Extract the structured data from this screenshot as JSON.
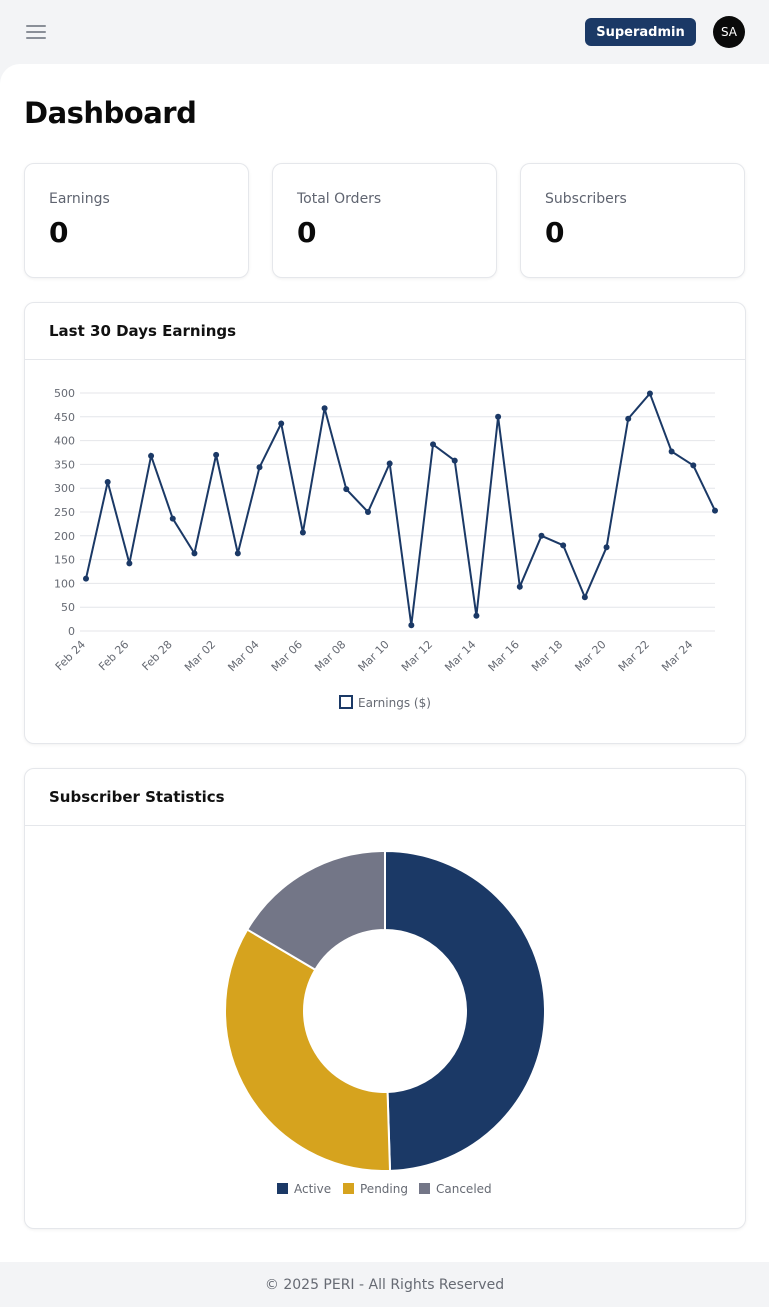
{
  "header": {
    "role_badge": "Superadmin",
    "avatar_initials": "SA"
  },
  "page": {
    "title": "Dashboard"
  },
  "stats": [
    {
      "label": "Earnings",
      "value": "0"
    },
    {
      "label": "Total Orders",
      "value": "0"
    },
    {
      "label": "Subscribers",
      "value": "0"
    }
  ],
  "earnings_panel": {
    "title": "Last 30 Days Earnings"
  },
  "subscriber_panel": {
    "title": "Subscriber Statistics"
  },
  "footer": {
    "text": "© 2025 PERI - All Rights Reserved"
  },
  "colors": {
    "primary": "#1b3966",
    "pending": "#d6a31e",
    "canceled": "#737687"
  },
  "chart_data": [
    {
      "type": "line",
      "x": [
        "Feb 24",
        "Feb 25",
        "Feb 26",
        "Feb 27",
        "Feb 28",
        "Mar 01",
        "Mar 02",
        "Mar 03",
        "Mar 04",
        "Mar 05",
        "Mar 06",
        "Mar 07",
        "Mar 08",
        "Mar 09",
        "Mar 10",
        "Mar 11",
        "Mar 12",
        "Mar 13",
        "Mar 14",
        "Mar 15",
        "Mar 16",
        "Mar 17",
        "Mar 18",
        "Mar 19",
        "Mar 20",
        "Mar 21",
        "Mar 22",
        "Mar 23",
        "Mar 24",
        "Mar 25"
      ],
      "tick_labels": [
        "Feb 24",
        "Feb 26",
        "Feb 28",
        "Mar 02",
        "Mar 04",
        "Mar 06",
        "Mar 08",
        "Mar 10",
        "Mar 12",
        "Mar 14",
        "Mar 16",
        "Mar 18",
        "Mar 20",
        "Mar 22",
        "Mar 24"
      ],
      "series": [
        {
          "name": "Earnings ($)",
          "values": [
            110,
            313,
            142,
            368,
            236,
            163,
            370,
            163,
            344,
            436,
            207,
            468,
            298,
            250,
            352,
            12,
            392,
            358,
            32,
            450,
            93,
            200,
            180,
            71,
            176,
            446,
            499,
            377,
            348,
            253
          ]
        }
      ],
      "ylim": [
        0,
        500
      ],
      "yticks": [
        0,
        50,
        100,
        150,
        200,
        250,
        300,
        350,
        400,
        450,
        500
      ],
      "grid": true,
      "legend": "bottom",
      "color": "#1b3966"
    },
    {
      "type": "pie",
      "donut": true,
      "categories": [
        "Active",
        "Pending",
        "Canceled"
      ],
      "values": [
        49.5,
        34.0,
        16.5
      ],
      "colors": [
        "#1b3966",
        "#d6a31e",
        "#737687"
      ],
      "legend": "bottom"
    }
  ]
}
